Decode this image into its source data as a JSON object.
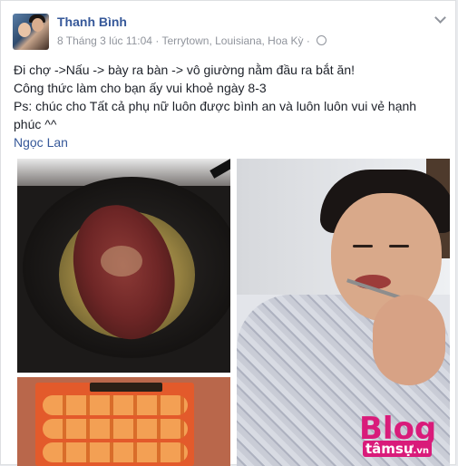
{
  "post": {
    "author": "Thanh Bình",
    "timestamp": "8 Tháng 3 lúc 11:04",
    "separator": "·",
    "location": "Terrytown, Louisiana, Hoa Kỳ",
    "separator2": "·",
    "privacy_icon": "globe-icon",
    "menu_icon": "chevron-down-icon",
    "lines": [
      "Đi chợ ->Nấu -> bày ra bàn -> vô giường nằm đầu ra bắt ăn!",
      "Công thức làm cho bạn ấy vui khoẻ ngày 8-3",
      "Ps: chúc cho Tất cả phụ nữ luôn được bình an và luôn luôn vui vẻ hạnh",
      "phúc ^^"
    ],
    "mention": "Ngọc Lan"
  },
  "photos": [
    {
      "subject": "steak in frying pan"
    },
    {
      "subject": "woman eating with fork"
    },
    {
      "subject": "boxed sweets"
    }
  ],
  "watermark": {
    "brand": "Blog",
    "sub": "tâmsự",
    "tld": ".vn",
    "color": "#d91b7a"
  },
  "colors": {
    "link": "#365899",
    "meta": "#90949c",
    "text": "#1d2129"
  }
}
